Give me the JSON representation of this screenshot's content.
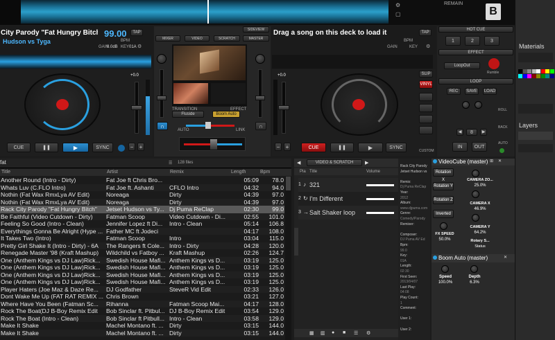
{
  "deck_left": {
    "title": "City Parody \"Fat Hungry Bitch\" (",
    "artist": "Hudson vs Tyga",
    "bpm": "99.00",
    "bpm_label": "BPM",
    "gain": "GAIN",
    "gain_val": "0.0dB",
    "key": "KEY",
    "key_val": "01A",
    "tap": "TAP",
    "pitch": "+0.0",
    "cue": "CUE",
    "play": "▶",
    "pause": "❚❚",
    "sync": "SYNC"
  },
  "deck_right": {
    "title": "Drag a song on this deck to load it",
    "bpm_label": "BPM",
    "gain": "GAIN",
    "key": "KEY",
    "tap": "TAP",
    "pitch": "+0.0",
    "cue": "CUE",
    "pause": "❚❚",
    "play": "▶",
    "sync": "SYNC",
    "slip": "SLIP",
    "vinyl": "VINYL",
    "custom": "CUSTOM"
  },
  "top": {
    "remain": "REMAIN",
    "deck_letter": "B"
  },
  "mixer": {
    "tabs": [
      "MIXER",
      "VIDEO",
      "SCRATCH",
      "MASTER"
    ],
    "sidebar": "SIDEVIEW",
    "transition": "TRANSITION",
    "effect": "EFFECT",
    "transition_val": "Fluside",
    "effect_val": "Boom Auto",
    "auto": "AUTO",
    "link": "LINK"
  },
  "right_controls": {
    "hot_cue": "HOT CUE",
    "cues": [
      "1",
      "2",
      "3"
    ],
    "effect": "EFFECT",
    "effect_val": "LoopOut",
    "rumble": "Rumble",
    "loop": "LOOP",
    "loop_btns": [
      "REC",
      "SAVE",
      "LOAD"
    ],
    "loop_len": "8",
    "in": "IN",
    "out": "OUT",
    "roll": "ROLL",
    "back": "BACK",
    "auto": "AUTO"
  },
  "browser": {
    "search_value": "fat",
    "count": "128 files",
    "columns": [
      "Title",
      "Artist",
      "Remix",
      "Length",
      "Bpm"
    ],
    "rows": [
      [
        "Another Round (Intro - Dirty)",
        "Fat Joe ft Chris Bro...",
        "",
        "05:09",
        "78.0"
      ],
      [
        "Whats Luv (C.FLO Intro)",
        "Fat Joe ft. Ashanti",
        "CFLO Intro",
        "04:32",
        "94.0"
      ],
      [
        "Nothin (Fat Wax RmxLya AV Edit)",
        "Noreaga",
        "Dirty",
        "04:39",
        "97.0"
      ],
      [
        "Nothin (Fat Wax RmxLya AV Edit)",
        "Noreaga",
        "Dirty",
        "04:39",
        "97.0"
      ],
      [
        "Rack City Parody \"Fat Hungry Bitch\"",
        "Jetset Hudson vs Ty...",
        "Dj Puma ReClap",
        "02:30",
        "99.0"
      ],
      [
        "Be Faithful (Video Cutdown - Dirty)",
        "Fatman Scoop",
        "Video Cutdown - Di...",
        "02:55",
        "101.0"
      ],
      [
        "Feeling So Good (Intro - Clean)",
        "Jennifer Lopez ft Di...",
        "Intro - Clean",
        "05:14",
        "106.8"
      ],
      [
        "Everythings Gonna Be Alright (Hype ...",
        "Father MC ft Jodeci",
        "",
        "04:17",
        "108.0"
      ],
      [
        "It Takes Two (Intro)",
        "Fatman Scoop",
        "Intro",
        "03:04",
        "115.0"
      ],
      [
        "Pretty Girl Shake It (Intro - Dirty) - 6A",
        "The Rangers ft Cole...",
        "Intro - Dirty",
        "04:28",
        "120.0"
      ],
      [
        "Renegade Master '98 (Kraft Mashup)",
        "Wildchild vs Fatboy ...",
        "Kraft Mashup",
        "02:26",
        "124.7"
      ],
      [
        "One (Anthem Kings vs DJ Law)Rick...",
        "Swedish House Mafi...",
        "Anthem Kings vs D...",
        "03:19",
        "125.0"
      ],
      [
        "One (Anthem Kings vs DJ Law)Rick...",
        "Swedish House Mafi...",
        "Anthem Kings vs D...",
        "03:19",
        "125.0"
      ],
      [
        "One (Anthem Kings vs DJ Law)Rick...",
        "Swedish House Mafi...",
        "Anthem Kings vs D...",
        "03:19",
        "125.0"
      ],
      [
        "One (Anthem Kings vs DJ Law)Rick...",
        "Swedish House Mafi...",
        "Anthem Kings vs D...",
        "03:19",
        "125.0"
      ],
      [
        "Player Haters (Joe Maz & Daze Re...",
        "DJ Godfather",
        "SteveR Vid Edit",
        "02:33",
        "126.0"
      ],
      [
        "Dont Wake Me Up (FAT RAT REMIX ...",
        "Chris Brown",
        "",
        "03:21",
        "127.0"
      ],
      [
        "Where Have You Been (Fatman Sc...",
        "Rihanna",
        "Fatman Scoop Mai...",
        "04:17",
        "128.0"
      ],
      [
        "Rock The Boat(DJ B-Boy Remix Edit",
        "Bob Sinclar ft. Pitbul...",
        "DJ B-Boy Remix Edit",
        "03:54",
        "129.0"
      ],
      [
        "Rock The Boat (Intro - Clean)",
        "Bob Sinclar ft Pitbull...",
        "Intro - Clean",
        "03:58",
        "129.0"
      ],
      [
        "Make It Shake",
        "Machel Montano ft. ...",
        "Dirty",
        "03:15",
        "144.0"
      ],
      [
        "Make It Shake",
        "Machel Montano ft. ...",
        "Dirty",
        "03:15",
        "144.0"
      ]
    ]
  },
  "sampler": {
    "tab": "VIDEO & SCRATCH",
    "col_pla": "Pla",
    "col_title": "Title",
    "col_volume": "Volume",
    "items": [
      {
        "num": "1",
        "title": "321"
      },
      {
        "num": "2",
        "title": "I'm Different"
      },
      {
        "num": "3",
        "title": "Salt Shaker loop"
      }
    ]
  },
  "info": {
    "lines": [
      "Rack City Parody",
      "Jetset Hudson vs",
      "",
      "Remix:",
      "Dj Puma ReClap",
      "Year:",
      "2012",
      "Album:",
      "www.djpuma.com",
      "Genre:",
      "Comedy/Parody",
      "Remixer:",
      "",
      "Composer:",
      "DJ Puma AV Ed",
      "Bpm:",
      "99.0",
      "Key:",
      "01A",
      "Length:",
      "02:30",
      "First Seen:",
      "2013/04/07",
      "Last Play:",
      "04:08",
      "Play Count:",
      "1",
      "Comment:",
      "",
      "User 1:",
      "",
      "User 2:"
    ]
  },
  "fx": {
    "videocube_title": "VideoCube (master)",
    "rotation_btns": [
      "Rotation X",
      "Rotation Y",
      "Rotation Z",
      "Inverted"
    ],
    "params": [
      {
        "label": "CAMERA ZO...",
        "value": "25.0%"
      },
      {
        "label": "CAMERA X",
        "value": "46.9%"
      },
      {
        "label": "CAMERA Y",
        "value": "64.2%"
      },
      {
        "label": "FX SPEED",
        "value": "50.0%"
      },
      {
        "label": "Rotary S...",
        "value": "Status"
      }
    ],
    "boom_title": "Boom Auto (master)",
    "boom_params": [
      {
        "label": "Speed",
        "value": "100.0%"
      },
      {
        "label": "Depth",
        "value": "6.3%"
      }
    ]
  },
  "side": {
    "materials": "Materials",
    "layers": "Layers"
  },
  "colors": {
    "accent": "#2aa0e0",
    "red": "#d01818"
  }
}
